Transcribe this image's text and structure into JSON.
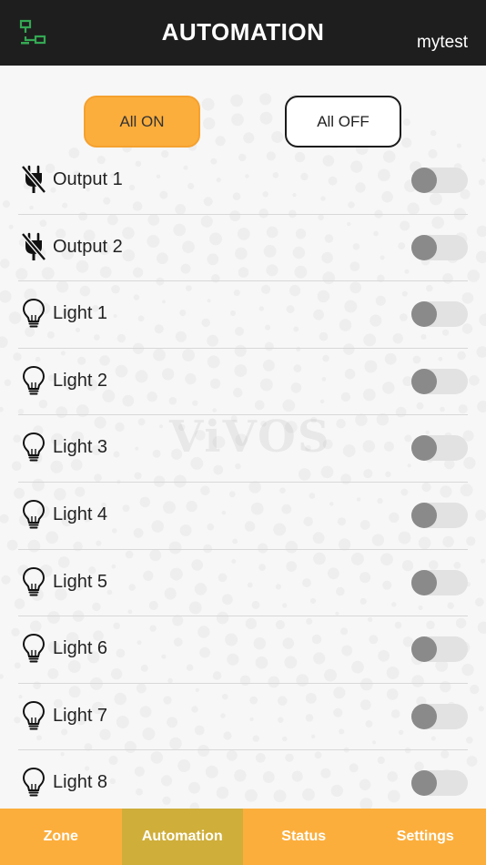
{
  "header": {
    "title": "AUTOMATION",
    "user": "mytest",
    "icon": "network-icon",
    "icon_color": "#34a853"
  },
  "watermark": {
    "text": "ViVOS"
  },
  "controls": {
    "all_on_label": "All ON",
    "all_off_label": "All OFF",
    "accent_color": "#fcae3c"
  },
  "items": [
    {
      "label": "Output 1",
      "icon": "power-plug-off-icon",
      "on": false
    },
    {
      "label": "Output 2",
      "icon": "power-plug-off-icon",
      "on": false
    },
    {
      "label": "Light 1",
      "icon": "lightbulb-icon",
      "on": false
    },
    {
      "label": "Light 2",
      "icon": "lightbulb-icon",
      "on": false
    },
    {
      "label": "Light 3",
      "icon": "lightbulb-icon",
      "on": false
    },
    {
      "label": "Light 4",
      "icon": "lightbulb-icon",
      "on": false
    },
    {
      "label": "Light 5",
      "icon": "lightbulb-icon",
      "on": false
    },
    {
      "label": "Light 6",
      "icon": "lightbulb-icon",
      "on": false
    },
    {
      "label": "Light 7",
      "icon": "lightbulb-icon",
      "on": false
    },
    {
      "label": "Light 8",
      "icon": "lightbulb-icon",
      "on": false
    }
  ],
  "tabs": [
    {
      "label": "Zone",
      "active": false
    },
    {
      "label": "Automation",
      "active": true
    },
    {
      "label": "Status",
      "active": false
    },
    {
      "label": "Settings",
      "active": false
    }
  ]
}
